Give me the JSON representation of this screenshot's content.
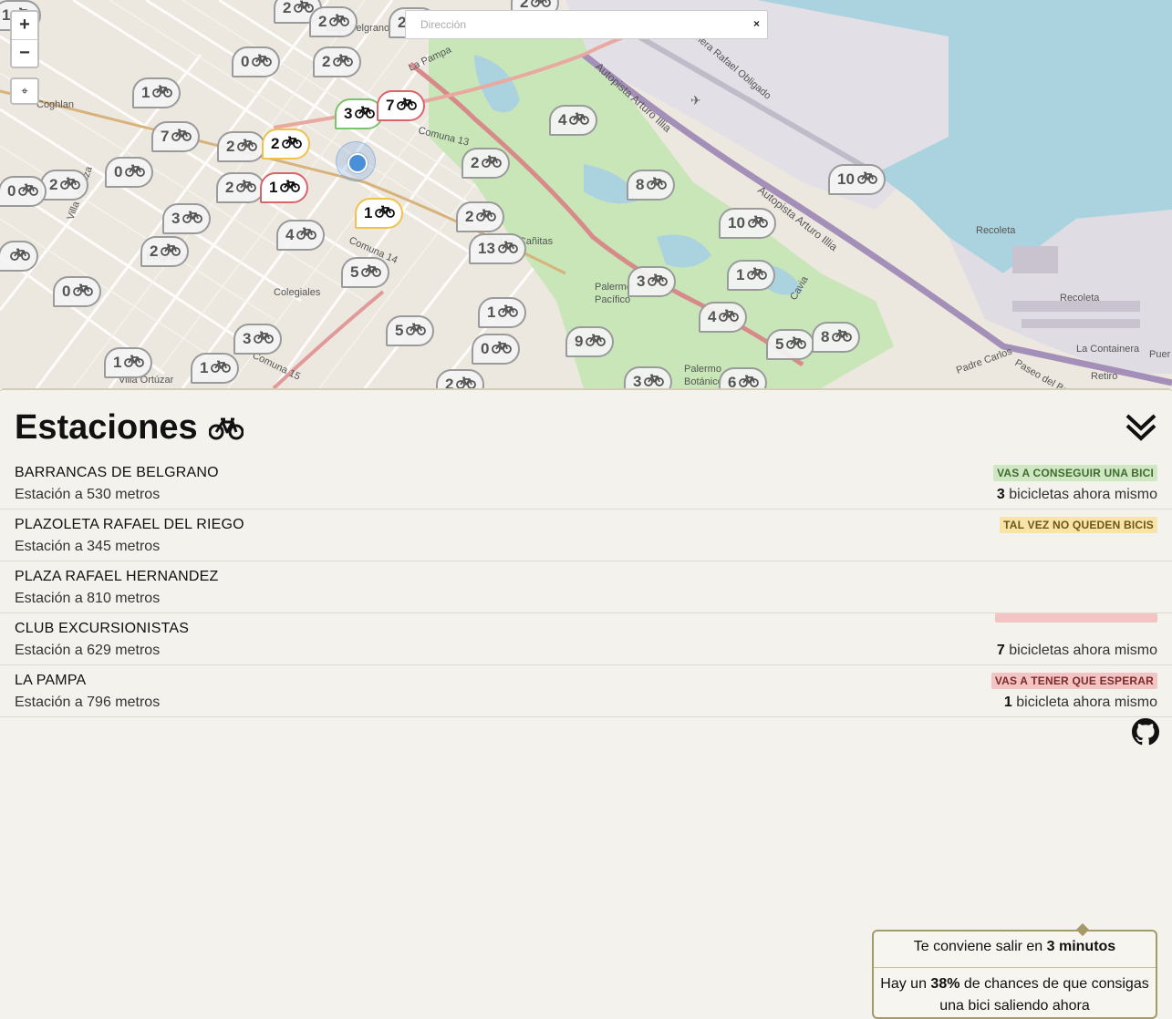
{
  "map": {
    "search": {
      "placeholder": "Dirección",
      "clear": "×"
    },
    "zoom_in": "+",
    "zoom_out": "−",
    "locate": "⌖",
    "labels": [
      "Bajo Belgrano",
      "La Pampa",
      "Autopista Arturo Illia",
      "Costanera Rafael Obligado",
      "Comuna 13",
      "Comuna 14",
      "Comuna 15",
      "Palermo",
      "Belgrano",
      "Colegiales",
      "Villa Urquiza",
      "Villa Ortúzar",
      "Coghlan",
      "Las Cañitas",
      "Palermo Pacífico",
      "Palermo Botánico",
      "Recoleta",
      "La Containera",
      "Paseo del Bajo",
      "Retiro",
      "Cavia",
      "Padre Carlos"
    ],
    "markers": [
      {
        "count": "1",
        "state": "gray"
      },
      {
        "count": "2",
        "state": "gray"
      },
      {
        "count": "2",
        "state": "gray"
      },
      {
        "count": "2",
        "state": "gray"
      },
      {
        "count": "0",
        "state": "gray"
      },
      {
        "count": "2",
        "state": "gray"
      },
      {
        "count": "1",
        "state": "gray"
      },
      {
        "count": "2",
        "state": "gray"
      },
      {
        "count": "7",
        "state": "gray"
      },
      {
        "count": "2",
        "state": "gray"
      },
      {
        "count": "0",
        "state": "gray"
      },
      {
        "count": "2",
        "state": "gray"
      },
      {
        "count": "0",
        "state": "gray"
      },
      {
        "count": "2",
        "state": "gray"
      },
      {
        "count": "3",
        "state": "gray"
      },
      {
        "count": "2",
        "state": "gray"
      },
      {
        "count": "0",
        "state": "gray"
      },
      {
        "count": "4",
        "state": "gray"
      },
      {
        "count": "5",
        "state": "gray"
      },
      {
        "count": "3",
        "state": "gray"
      },
      {
        "count": "1",
        "state": "gray"
      },
      {
        "count": "1",
        "state": "gray"
      },
      {
        "count": "5",
        "state": "gray"
      },
      {
        "count": "1",
        "state": "gray"
      },
      {
        "count": "0",
        "state": "gray"
      },
      {
        "count": "2",
        "state": "gray"
      },
      {
        "count": "2",
        "state": "gray"
      },
      {
        "count": "13",
        "state": "gray"
      },
      {
        "count": "4",
        "state": "gray"
      },
      {
        "count": "8",
        "state": "gray"
      },
      {
        "count": "10",
        "state": "gray"
      },
      {
        "count": "10",
        "state": "gray"
      },
      {
        "count": "3",
        "state": "gray"
      },
      {
        "count": "1",
        "state": "gray"
      },
      {
        "count": "4",
        "state": "gray"
      },
      {
        "count": "9",
        "state": "gray"
      },
      {
        "count": "5",
        "state": "gray"
      },
      {
        "count": "8",
        "state": "gray"
      },
      {
        "count": "3",
        "state": "gray"
      },
      {
        "count": "6",
        "state": "gray"
      },
      {
        "count": "2",
        "state": "gray"
      },
      {
        "count": "",
        "state": "gray"
      },
      {
        "count": "3",
        "state": "green"
      },
      {
        "count": "7",
        "state": "red"
      },
      {
        "count": "2",
        "state": "yellow"
      },
      {
        "count": "1",
        "state": "red"
      },
      {
        "count": "1",
        "state": "yellow"
      }
    ]
  },
  "panel": {
    "title": "Estaciones",
    "stations": [
      {
        "name": "BARRANCAS DE BELGRANO",
        "distance": "Estación a 530 metros",
        "badge": "VAS A CONSEGUIR UNA BICI",
        "badge_color": "#cfe7c3",
        "badge_text": "#3f6b2f",
        "count": "3",
        "count_suffix": " bicicletas ahora mismo"
      },
      {
        "name": "PLAZOLETA RAFAEL DEL RIEGO",
        "distance": "Estación a 345 metros",
        "badge": "TAL VEZ NO QUEDEN BICIS",
        "badge_color": "#f8e3a8",
        "badge_text": "#6e5616",
        "count": "",
        "count_suffix": ""
      },
      {
        "name": "PLAZA RAFAEL HERNANDEZ",
        "distance": "Estación a 810 metros",
        "badge": "",
        "badge_color": "",
        "badge_text": "",
        "count": "",
        "count_suffix": ""
      },
      {
        "name": "CLUB EXCURSIONISTAS",
        "distance": "Estación a 629 metros",
        "badge": "",
        "badge_color": "#f2c4c4",
        "badge_text": "#7d2a2a",
        "count": "7",
        "count_suffix": " bicicletas ahora mismo"
      },
      {
        "name": "LA PAMPA",
        "distance": "Estación a 796 metros",
        "badge": "VAS A TENER QUE ESPERAR",
        "badge_color": "#f2c4c4",
        "badge_text": "#7d2a2a",
        "count": "1",
        "count_suffix": " bicicleta ahora mismo"
      }
    ],
    "popover": {
      "line1_pre": "Te conviene salir en ",
      "line1_bold": "3 minutos",
      "line2_pre": "Hay un ",
      "line2_bold": "38%",
      "line2_post": " de chances de que consigas una bici saliendo ahora"
    }
  },
  "colors": {
    "green": "#7bc36b",
    "yellow": "#f0c24a",
    "red": "#d9646a",
    "water": "#aad3df",
    "park": "#c8e6b8"
  }
}
